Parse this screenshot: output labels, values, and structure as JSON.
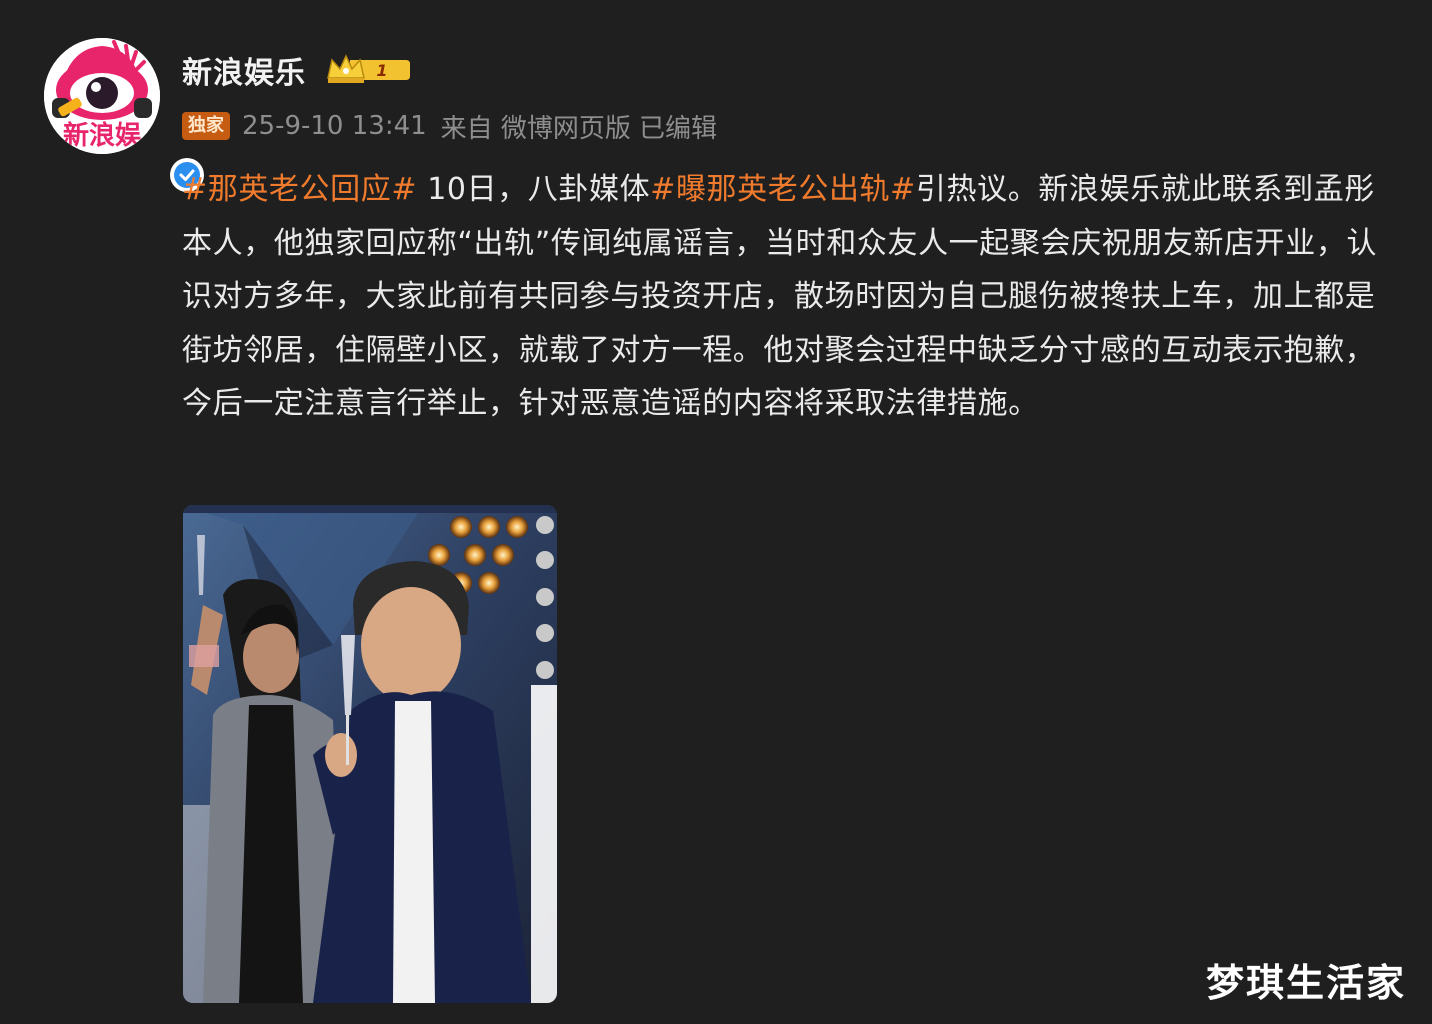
{
  "author": {
    "name": "新浪娱乐",
    "avatar_text": "新浪娱",
    "level_badge": "1",
    "verified_icon": "verified-check-icon"
  },
  "meta": {
    "tag": "独家",
    "time": "25-9-10 13:41",
    "source": "来自 微博网页版",
    "edited": "已编辑"
  },
  "content": {
    "topic1": "#那英老公回应#",
    "text1": " 10日，八卦媒体",
    "topic2": "#曝那英老公出轨#",
    "text2": "引热议。新浪娱乐就此联系到孟彤本人，他独家回应称“出轨”传闻纯属谣言，当时和众友人一起聚会庆祝朋友新店开业，认识对方多年，大家此前有共同参与投资开店，散场时因为自己腿伤被搀扶上车，加上都是街坊邻居，住隔壁小区，就载了对方一程。他对聚会过程中缺乏分寸感的互动表示抱歉，今后一定注意言行举止，针对恶意造谣的内容将采取法律措施。"
  },
  "watermark": "梦琪生活家",
  "colors": {
    "background": "#1f1f1f",
    "topic": "#f07b2d",
    "tag": "#c65c12",
    "verified": "#2b8ff0"
  }
}
